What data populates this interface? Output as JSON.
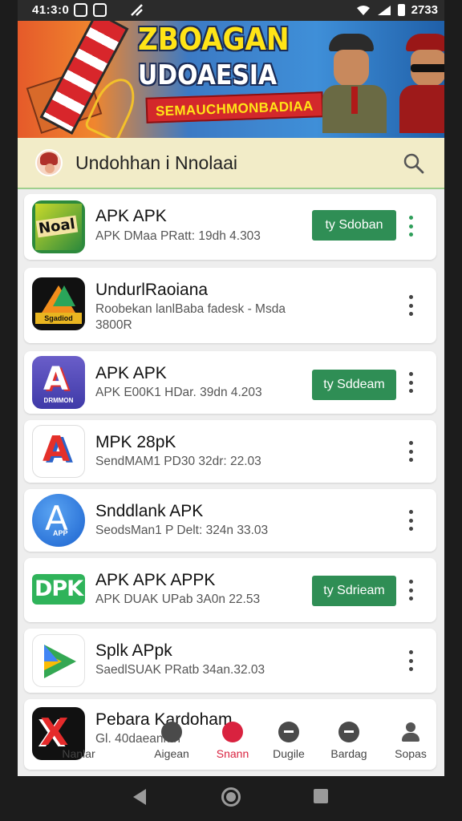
{
  "status_bar": {
    "time": "41:3:0",
    "clock_right": "2733",
    "icons": [
      "notification-icon",
      "gallery-icon",
      "signal-icon",
      "wifi-icon",
      "battery-icon"
    ]
  },
  "banner": {
    "title_line1": "ZBOAGAN",
    "title_line2": "UDOAESIA",
    "subtitle": "SEMAUCHMONBADIAA"
  },
  "header": {
    "title": "Undohhan i Nnolaai",
    "search_icon": "search-icon"
  },
  "apps": [
    {
      "name": "APK APK",
      "meta1": "APK DMaa PRatt: 19dh 4.303",
      "meta2": "",
      "button": "ty Sdoban",
      "icon": "noal-app-icon",
      "icon_text": "Noal"
    },
    {
      "name": "UndurlRaoiana",
      "meta1": "Roobekan lanlBaba fadesk - Msda",
      "meta2": "3800R",
      "button": "",
      "icon": "dark-triangle-app-icon",
      "icon_text": "Sgadiod"
    },
    {
      "name": "APK APK",
      "meta1": "APK E00K1 HDar. 39dn 4.203",
      "meta2": "",
      "button": "ty Sddeam",
      "icon": "purple-a-app-icon",
      "icon_text": "DRMMON"
    },
    {
      "name": "MPK 28pK",
      "meta1": "SendMAM1 PD30 32dr: 22.03",
      "meta2": "",
      "button": "",
      "icon": "red-blue-a-app-icon",
      "icon_text": ""
    },
    {
      "name": "Snddlank APK",
      "meta1": "SeodsMan1 P Delt: 324n 33.03",
      "meta2": "",
      "button": "",
      "icon": "blue-circle-a-app-icon",
      "icon_text": "APP"
    },
    {
      "name": "APK APK APPK",
      "meta1": "APK DUAK UPab 3A0n 22.53",
      "meta2": "",
      "button": "ty Sdrieam",
      "icon": "dpk-app-icon",
      "icon_text": "DPK"
    },
    {
      "name": "Splk APpk",
      "meta1": "SaedlSUAK PRatb 34an.32.03",
      "meta2": "",
      "button": "",
      "icon": "play-triangle-app-icon",
      "icon_text": ""
    },
    {
      "name": "Pebara Kardoham",
      "meta1": "Gl. 40daeanmn",
      "meta2": "",
      "button": "",
      "icon": "red-x-app-icon",
      "icon_text": ""
    }
  ],
  "bottom_nav": [
    {
      "label": "Nanlar",
      "icon": "home-icon"
    },
    {
      "label": "Aigean",
      "icon": "compass-icon"
    },
    {
      "label": "Snann",
      "icon": "apps-icon",
      "active": true
    },
    {
      "label": "Dugile",
      "icon": "minus-circle-icon"
    },
    {
      "label": "Bardag",
      "icon": "controller-icon"
    },
    {
      "label": "Sopas",
      "icon": "person-icon"
    }
  ],
  "colors": {
    "install_button": "#2f8e55",
    "active_nav": "#d9223f",
    "header_bg": "#f2ecc8"
  }
}
